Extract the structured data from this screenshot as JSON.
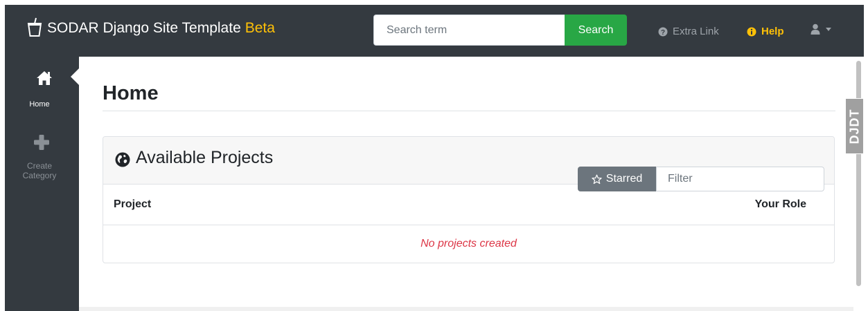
{
  "navbar": {
    "brand_title": "SODAR Django Site Template",
    "brand_badge": "Beta",
    "search_placeholder": "Search term",
    "search_button": "Search",
    "extra_link": "Extra Link",
    "help_link": "Help",
    "icons": {
      "brand": "cup-icon",
      "extra_link": "question-circle-icon",
      "help": "info-circle-icon",
      "user": "user-icon",
      "user_caret": "chevron-down-icon"
    }
  },
  "sidebar": {
    "items": [
      {
        "label": "Home",
        "icon": "home-icon",
        "active": true
      },
      {
        "label": "Create Category",
        "icon": "plus-icon",
        "active": false
      }
    ]
  },
  "main": {
    "page_title": "Home",
    "projects_card": {
      "title": "Available Projects",
      "title_icon": "globe-icon",
      "starred_button": "Starred",
      "starred_icon": "star-outline-icon",
      "filter_placeholder": "Filter",
      "columns": [
        "Project",
        "Your Role"
      ],
      "empty_message": "No projects created"
    }
  },
  "debug_toolbar": {
    "handle_label": "DJDT"
  },
  "colors": {
    "navbar_bg": "#343a40",
    "brand_badge": "#ffc107",
    "help_link": "#ffc107",
    "search_button_bg": "#28a745",
    "starred_button_bg": "#6c757d",
    "empty_message": "#dc3545"
  }
}
